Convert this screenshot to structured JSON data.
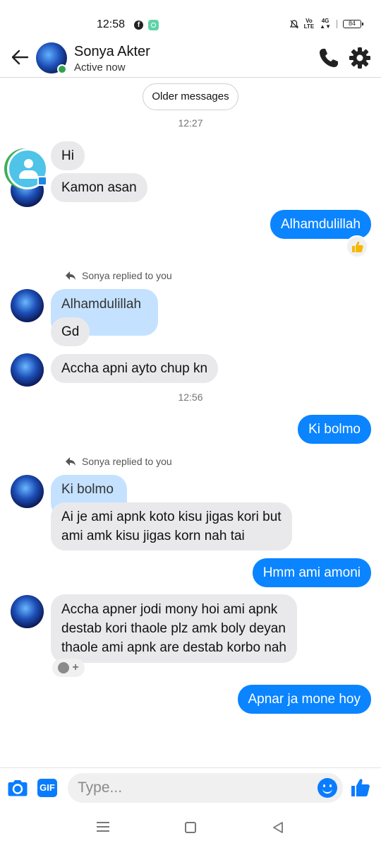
{
  "status_bar": {
    "time": "12:58",
    "network_top": "Vo",
    "network_bottom": "LTE",
    "signal_label": "4G",
    "battery": "84",
    "icons": [
      "facebook-icon",
      "app-icon",
      "mute-icon",
      "signal-icon",
      "battery-icon"
    ]
  },
  "header": {
    "contact_name": "Sonya Akter",
    "status": "Active now",
    "icons": [
      "back-arrow-icon",
      "phone-icon",
      "gear-icon"
    ]
  },
  "conversation": {
    "older_messages_label": "Older messages",
    "timestamps": [
      "12:27",
      "12:56"
    ],
    "reply_note": "Sonya replied to you",
    "messages": [
      {
        "id": "m1",
        "from": "them",
        "text": "Hi"
      },
      {
        "id": "m2",
        "from": "them",
        "text": "Kamon asan"
      },
      {
        "id": "m3",
        "from": "me",
        "text": "Alhamdulillah",
        "reaction": "thumbs-up"
      },
      {
        "id": "m4",
        "from": "them",
        "quoted": "Alhamdulillah",
        "text": "Gd"
      },
      {
        "id": "m5",
        "from": "them",
        "text": "Accha apni ayto chup kn"
      },
      {
        "id": "m6",
        "from": "me",
        "text": "Ki bolmo"
      },
      {
        "id": "m7",
        "from": "them",
        "quoted": "Ki bolmo",
        "lines": [
          "Ai je ami apnk koto kisu jigas kori but",
          "ami amk kisu jigas korn nah tai"
        ]
      },
      {
        "id": "m8",
        "from": "me",
        "text": "Hmm ami amoni"
      },
      {
        "id": "m9",
        "from": "them",
        "lines": [
          "Accha  apner jodi  mony hoi  ami apnk",
          "destab  kori thaole plz amk boly deyan",
          "thaole ami apnk are destab korbo nah"
        ]
      },
      {
        "id": "m10",
        "from": "me",
        "text": "Apnar ja mone hoy"
      }
    ]
  },
  "composer": {
    "placeholder": "Type...",
    "gif_label": "GIF",
    "icons": [
      "camera-icon",
      "emoji-icon",
      "thumbs-up-icon"
    ]
  },
  "colors": {
    "outgoing_bubble": "#0a84ff",
    "incoming_bubble": "#e9e9eb",
    "quoted_bubble": "#c4e1ff",
    "accent": "#0a7cff",
    "online": "#31a24c"
  }
}
